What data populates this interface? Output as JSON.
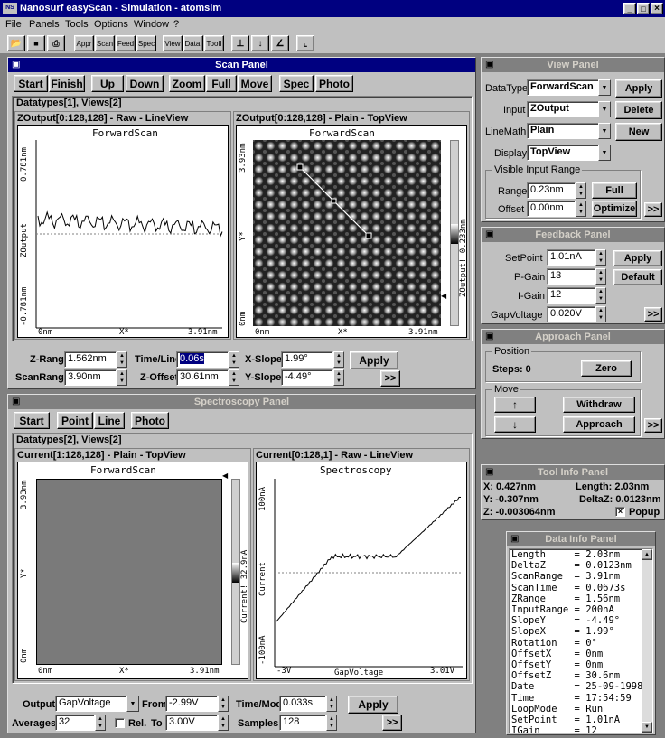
{
  "window": {
    "title": "Nanosurf easyScan - Simulation - atomsim",
    "menu": [
      "File",
      "Panels",
      "Tools",
      "Options",
      "Window",
      "?"
    ],
    "toolbar": [
      "Appr",
      "Scan",
      "Feed",
      "Spec",
      "View",
      "DataI",
      "ToolI"
    ],
    "controls": [
      "_",
      "□",
      "×"
    ]
  },
  "scan_panel": {
    "title": "Scan Panel",
    "buttons": [
      "Start",
      "Finish",
      "Up",
      "Down",
      "Zoom",
      "Full",
      "Move",
      "Spec",
      "Photo"
    ],
    "datatypes": "Datatypes[1], Views[2]",
    "lineview": {
      "caption": "ZOutput[0:128,128] - Raw - LineView",
      "title": "ForwardScan",
      "ymax": "0.781nm",
      "ymin": "-0.781nm",
      "ylabel": "ZOutput",
      "xmin": "0nm",
      "xmid": "X*",
      "xmax": "3.91nm"
    },
    "topview": {
      "caption": "ZOutput[0:128,128] - Plain - TopView",
      "title": "ForwardScan",
      "ymax": "3.93nm",
      "ymid": "Y*",
      "ymin": "0nm",
      "xmin": "0nm",
      "xmid": "X*",
      "xmax": "3.91nm",
      "scale": "ZOutput! 0.233nm"
    },
    "fields": {
      "zrange_label": "Z-Range",
      "zrange": "1.562nm",
      "timeline_label": "Time/Line",
      "timeline": "0.06s",
      "xslope_label": "X-Slope",
      "xslope": "1.99°",
      "scanrange_label": "ScanRange",
      "scanrange": "3.90nm",
      "zoffset_label": "Z-Offset",
      "zoffset": "30.61nm",
      "yslope_label": "Y-Slope",
      "yslope": "-4.49°",
      "apply": "Apply",
      "more": ">>"
    }
  },
  "spec_panel": {
    "title": "Spectroscopy Panel",
    "buttons": [
      "Start",
      "Point",
      "Line",
      "Photo"
    ],
    "datatypes": "Datatypes[2], Views[2]",
    "topview": {
      "caption": "Current[1:128,128] - Plain - TopView",
      "title": "ForwardScan",
      "ymax": "3.93nm",
      "ymid": "Y*",
      "ymin": "0nm",
      "xmin": "0nm",
      "xmid": "X*",
      "xmax": "3.91nm",
      "scale": "Current! 32.9nA"
    },
    "lineview": {
      "caption": "Current[0:128,1] - Raw - LineView",
      "title": "Spectroscopy",
      "ymax": "100nA",
      "ymin": "-100nA",
      "ylabel": "Current",
      "xmin": "-3V",
      "xmid": "GapVoltage",
      "xmax": "3.01V"
    },
    "fields": {
      "output_label": "Output",
      "output": "GapVoltage",
      "from_label": "From",
      "from": "-2.99V",
      "timemod_label": "Time/Mod.",
      "timemod": "0.033s",
      "averages_label": "Averages",
      "averages": "32",
      "rel_label": "Rel.",
      "to_label": "To",
      "to": "3.00V",
      "samples_label": "Samples",
      "samples": "128",
      "apply": "Apply",
      "more": ">>"
    }
  },
  "view_panel": {
    "title": "View Panel",
    "datatype_label": "DataType",
    "datatype": "ForwardScan",
    "input_label": "Input",
    "input": "ZOutput",
    "linemath_label": "LineMath",
    "linemath": "Plain",
    "display_label": "Display",
    "display": "TopView",
    "apply": "Apply",
    "delete": "Delete",
    "new": "New",
    "group": "Visible Input Range",
    "range_label": "Range",
    "range": "0.23nm",
    "full": "Full",
    "offset_label": "Offset",
    "offset": "0.00nm",
    "optimize": "Optimize",
    "more": ">>"
  },
  "feedback_panel": {
    "title": "Feedback Panel",
    "setpoint_label": "SetPoint",
    "setpoint": "1.01nA",
    "pgain_label": "P-Gain",
    "pgain": "13",
    "igain_label": "I-Gain",
    "igain": "12",
    "gapvoltage_label": "GapVoltage",
    "gapvoltage": "0.020V",
    "apply": "Apply",
    "default": "Default",
    "more": ">>"
  },
  "approach_panel": {
    "title": "Approach Panel",
    "position_group": "Position",
    "steps": "Steps: 0",
    "zero": "Zero",
    "move_group": "Move",
    "up": "↑",
    "down": "↓",
    "withdraw": "Withdraw",
    "approach": "Approach",
    "more": ">>"
  },
  "toolinfo_panel": {
    "title": "Tool Info Panel",
    "x": "X: 0.427nm",
    "length": "Length: 2.03nm",
    "y": "Y: -0.307nm",
    "deltaz": "DeltaZ: 0.0123nm",
    "z": "Z: -0.003064nm",
    "popup": "Popup"
  },
  "datainfo_panel": {
    "title": "Data Info Panel",
    "rows": [
      [
        "Length",
        "2.03nm"
      ],
      [
        "DeltaZ",
        "0.0123nm"
      ],
      [
        "ScanRange",
        "3.91nm"
      ],
      [
        "ScanTime",
        "0.0673s"
      ],
      [
        "ZRange",
        "1.56nm"
      ],
      [
        "InputRange",
        "200nA"
      ],
      [
        "SlopeY",
        "-4.49°"
      ],
      [
        "SlopeX",
        "1.99°"
      ],
      [
        "Rotation",
        "0°"
      ],
      [
        "OffsetX",
        "0nm"
      ],
      [
        "OffsetY",
        "0nm"
      ],
      [
        "OffsetZ",
        "30.6nm"
      ],
      [
        "Date",
        "25-09-1998"
      ],
      [
        "Time",
        "17:54:59"
      ],
      [
        "LoopMode",
        "Run"
      ],
      [
        "SetPoint",
        "1.01nA"
      ],
      [
        "IGain",
        "12"
      ]
    ]
  }
}
